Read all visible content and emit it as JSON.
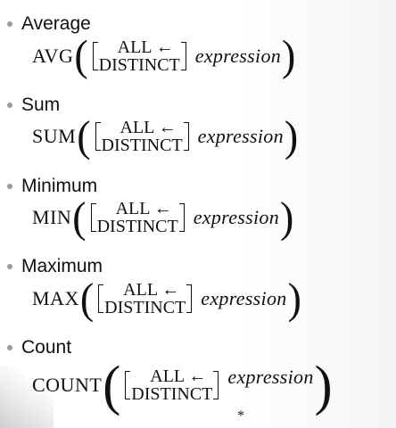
{
  "items": [
    {
      "label": "Average",
      "func": "AVG",
      "opt_all": "ALL ←",
      "opt_distinct": "DISTINCT",
      "expr": "expression"
    },
    {
      "label": "Sum",
      "func": "SUM",
      "opt_all": "ALL ←",
      "opt_distinct": "DISTINCT",
      "expr": "expression"
    },
    {
      "label": "Minimum",
      "func": "MIN",
      "opt_all": "ALL ←",
      "opt_distinct": "DISTINCT",
      "expr": "expression"
    },
    {
      "label": "Maximum",
      "func": "MAX",
      "opt_all": "ALL ←",
      "opt_distinct": "DISTINCT",
      "expr": "expression"
    },
    {
      "label": "Count",
      "func": "COUNT",
      "opt_all": "ALL ←",
      "opt_distinct": "DISTINCT",
      "expr": "expression",
      "suffix": "*"
    }
  ]
}
